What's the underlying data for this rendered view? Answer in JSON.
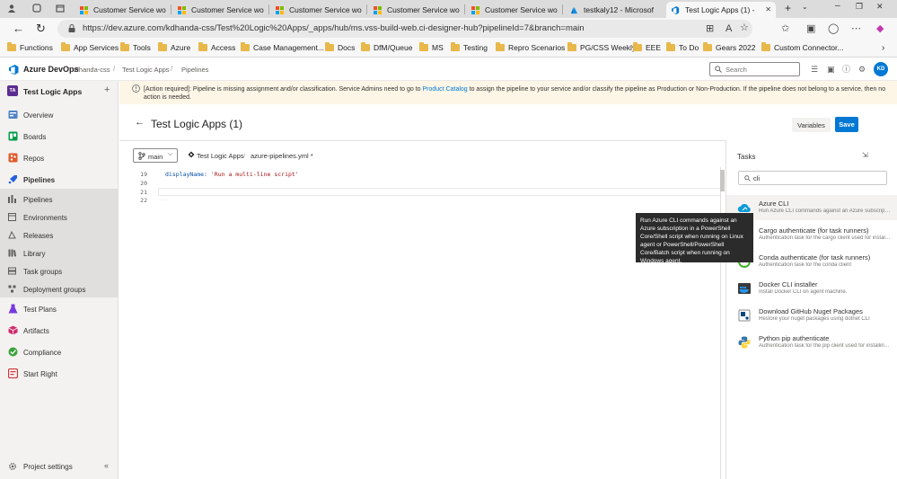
{
  "browser": {
    "tabs": [
      {
        "label": "Customer Service wo",
        "active": false
      },
      {
        "label": "Customer Service wo",
        "active": false
      },
      {
        "label": "Customer Service wo",
        "active": false
      },
      {
        "label": "Customer Service wo",
        "active": false
      },
      {
        "label": "Customer Service wo",
        "active": false
      },
      {
        "label": "testkaly12 - Microsof",
        "active": false
      },
      {
        "label": "Test Logic Apps (1) -",
        "active": true
      }
    ],
    "url_text": "https://dev.azure.com/kdhanda-css/Test%20Logic%20Apps/_apps/hub/ms.vss-build-web.ci-designer-hub?pipelineId=7&branch=main",
    "bookmarks": [
      "Functions",
      "App Services",
      "Tools",
      "Azure",
      "Access",
      "Case Management...",
      "Docs",
      "DfM/Queue",
      "MS",
      "Testing",
      "Repro Scenarios",
      "PG/CSS Weekly",
      "EEE",
      "To Do",
      "Gears 2022",
      "Custom Connector..."
    ]
  },
  "ado_header": {
    "brand": "Azure DevOps",
    "org": "kdhanda-css",
    "project": "Test Logic Apps",
    "section": "Pipelines",
    "search_placeholder": "Search",
    "avatar_initials": "KD"
  },
  "sidebar": {
    "project_badge": "TA",
    "project_name": "Test Logic Apps",
    "items": [
      {
        "label": "Overview",
        "icon": "overview-icon"
      },
      {
        "label": "Boards",
        "icon": "boards-icon"
      },
      {
        "label": "Repos",
        "icon": "repos-icon"
      },
      {
        "label": "Pipelines",
        "icon": "pipelines-icon"
      },
      {
        "label": "Pipelines",
        "icon": "pipelines-sub-icon"
      },
      {
        "label": "Environments",
        "icon": "environments-icon"
      },
      {
        "label": "Releases",
        "icon": "releases-icon"
      },
      {
        "label": "Library",
        "icon": "library-icon"
      },
      {
        "label": "Task groups",
        "icon": "task-groups-icon"
      },
      {
        "label": "Deployment groups",
        "icon": "deployment-groups-icon"
      },
      {
        "label": "Test Plans",
        "icon": "test-plans-icon"
      },
      {
        "label": "Artifacts",
        "icon": "artifacts-icon"
      },
      {
        "label": "Compliance",
        "icon": "compliance-icon"
      },
      {
        "label": "Start Right",
        "icon": "start-right-icon"
      }
    ],
    "settings_label": "Project settings"
  },
  "banner": {
    "prefix": "[Action required]: Pipeline is missing assignment and/or classification. Service Admins need to go to ",
    "link": "Product Catalog",
    "suffix": " to assign the pipeline to your service and/or classify the pipeline as Production or Non-Production. If the pipeline does not belong to a service, then no action is needed."
  },
  "page": {
    "title": "Test Logic Apps (1)",
    "variables_label": "Variables",
    "save_label": "Save"
  },
  "editor": {
    "branch": "main",
    "repo": "Test Logic Apps",
    "crumb_sep": "/",
    "file": "azure-pipelines.yml *",
    "lines": [
      {
        "num": "19",
        "key": "displayName:",
        "value": "'Run a multi-line script'"
      },
      {
        "num": "20",
        "key": "",
        "value": ""
      },
      {
        "num": "21",
        "key": "",
        "value": ""
      },
      {
        "num": "22",
        "key": "",
        "value": ""
      }
    ]
  },
  "tasks": {
    "title": "Tasks",
    "search_value": "cli",
    "items": [
      {
        "name": "Azure CLI",
        "desc": "Run Azure CLI commands against an Azure subscription in a PowerShell Core/Shell script when running on Linux agent or PowerShell/PowerShell Core/Batch script when running on Windows agent."
      },
      {
        "name": "Cargo authenticate (for task runners)",
        "desc": "Authentication task for the cargo client used for installing Cargo crates"
      },
      {
        "name": "Conda authenticate (for task runners)",
        "desc": "Authentication task for the conda client"
      },
      {
        "name": "Docker CLI installer",
        "desc": "Install Docker CLI on agent machine."
      },
      {
        "name": "Download GitHub Nuget Packages",
        "desc": "Restore your nuget packages using dotnet CLI"
      },
      {
        "name": "Python pip authenticate",
        "desc": "Authentication task for the pip client used for installing Python distributions"
      }
    ],
    "tooltip": "Run Azure CLI commands against an Azure subscription in a PowerShell Core/Shell script when running on Linux agent or PowerShell/PowerShell Core/Batch script when running on Windows agent."
  },
  "colors": {
    "accent": "#0078d4",
    "banner_bg": "#fdf6e7",
    "project_badge": "#5c2d91"
  }
}
